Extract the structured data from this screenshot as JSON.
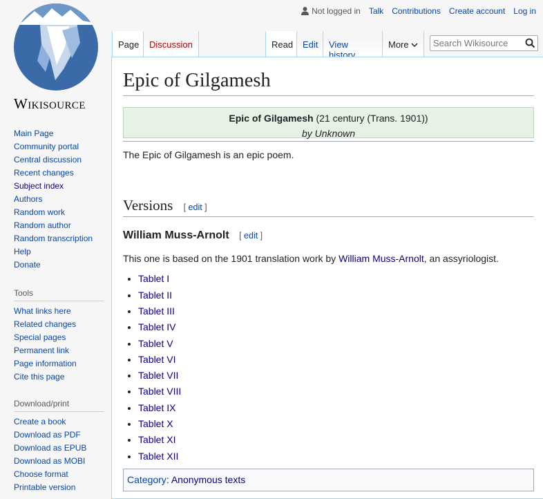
{
  "logo": {
    "wordmark": "Wikisource"
  },
  "personal": {
    "not_logged_in": "Not logged in",
    "talk": "Talk",
    "contributions": "Contributions",
    "create_account": "Create account",
    "log_in": "Log in"
  },
  "tabs": {
    "page": "Page",
    "discussion": "Discussion",
    "read": "Read",
    "edit": "Edit",
    "history": "View history",
    "more": "More"
  },
  "search": {
    "placeholder": "Search Wikisource"
  },
  "content": {
    "title": "Epic of Gilgamesh",
    "header": {
      "work_title": "Epic of Gilgamesh",
      "work_meta": "(21 century (Trans. 1901))",
      "author": "by Unknown"
    },
    "intro": "The Epic of Gilgamesh is an epic poem.",
    "versions_heading": "Versions",
    "edit_link": "edit",
    "translator_heading": "William Muss-Arnolt",
    "desc_before": "This one is based on the 1901 translation work by ",
    "desc_link": "William Muss-Arnolt",
    "desc_after": ", an assyriologist.",
    "tablets": [
      "Tablet I",
      "Tablet II",
      "Tablet III",
      "Tablet IV",
      "Tablet V",
      "Tablet VI",
      "Tablet VII",
      "Tablet VIII",
      "Tablet IX",
      "Tablet X",
      "Tablet XI",
      "Tablet XII"
    ],
    "category_label": "Category",
    "category_value": "Anonymous texts"
  },
  "sidebar": {
    "navigation": [
      "Main Page",
      "Community portal",
      "Central discussion",
      "Recent changes",
      "Subject index",
      "Authors",
      "Random work",
      "Random author",
      "Random transcription",
      "Help",
      "Donate"
    ],
    "tools_heading": "Tools",
    "tools": [
      "What links here",
      "Related changes",
      "Special pages",
      "Permanent link",
      "Page information",
      "Cite this page"
    ],
    "download_heading": "Download/print",
    "download": [
      "Create a book",
      "Download as PDF",
      "Download as EPUB",
      "Download as MOBI",
      "Choose format",
      "Printable version"
    ]
  }
}
